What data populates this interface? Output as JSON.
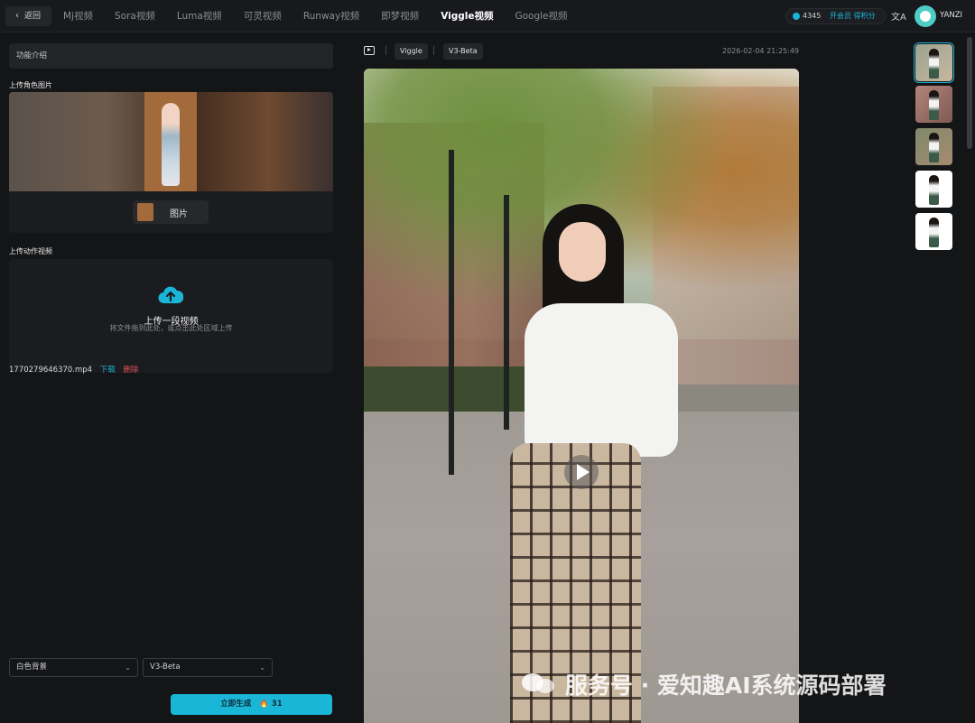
{
  "topbar": {
    "back_label": "返回",
    "tabs": [
      "Mj视频",
      "Sora视频",
      "Luma视频",
      "可灵视频",
      "Runway视频",
      "即梦视频",
      "Viggle视频",
      "Google视频"
    ],
    "active_tab": "Viggle视频",
    "credits": "4345",
    "vip_label": "开会员 得积分",
    "translate_icon": "文A",
    "username": "YANZI"
  },
  "left": {
    "intro_label": "功能介绍",
    "upload_character_label": "上传角色图片",
    "image_tag_label": "图片",
    "upload_motion_label": "上传动作视频",
    "upload_title": "上传一段视频",
    "upload_hint": "将文件拖到此处，或点击此处区域上传",
    "file_name": "1770279646370.mp4",
    "download_label": "下载",
    "delete_label": "删除",
    "background_select": "白色背景",
    "model_select": "V3-Beta",
    "generate_label": "立即生成",
    "generate_cost": "31"
  },
  "center": {
    "chip_provider": "Viggle",
    "chip_model": "V3-Beta",
    "timestamp": "2026-02-04 21:25:49"
  },
  "watermark": "服务号 · 爱知趣AI系统源码部署",
  "colors": {
    "accent": "#19b6d8",
    "danger": "#e0505a",
    "background": "#141517"
  }
}
